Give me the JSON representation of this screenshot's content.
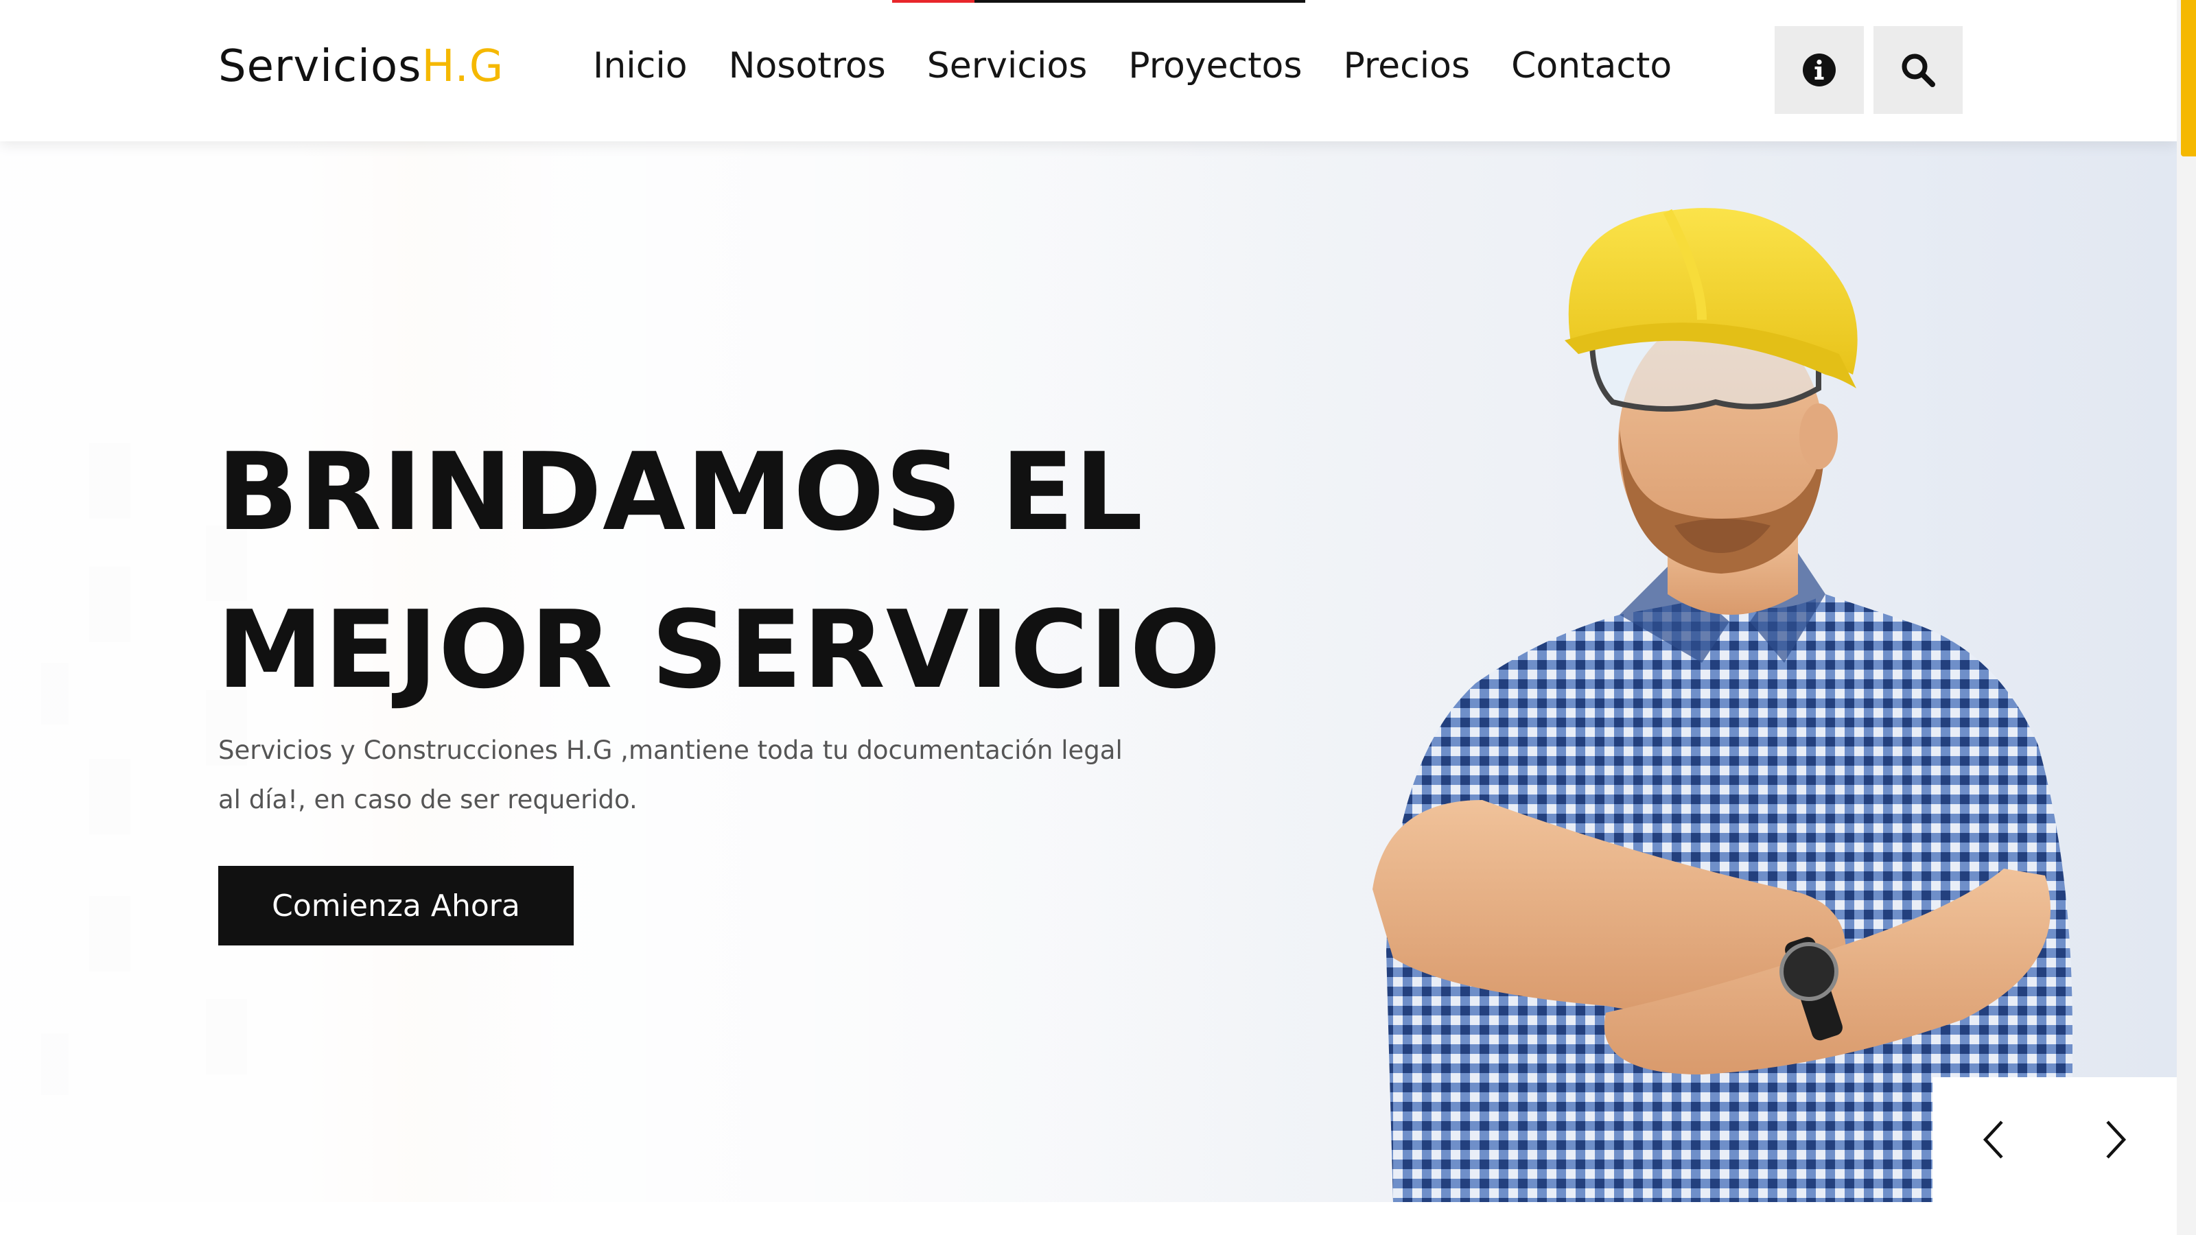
{
  "loading_bar": {
    "progress": 0.2
  },
  "header": {
    "logo": {
      "main": "Servicios",
      "accent": "H.G"
    },
    "nav": {
      "inicio": "Inicio",
      "nosotros": "Nosotros",
      "servicios": "Servicios",
      "proyectos": "Proyectos",
      "precios": "Precios",
      "contacto": "Contacto"
    },
    "icons": {
      "info": "info-icon",
      "search": "search-icon"
    }
  },
  "hero": {
    "headline_line1": "BRINDAMOS EL",
    "headline_line2": "MEJOR SERVICIO",
    "subtext": "Servicios y Construcciones H.G ,mantiene toda tu documentación legal al día!, en caso de ser requerido.",
    "cta_label": "Comienza Ahora"
  },
  "slider": {
    "prev_icon": "chevron-left-icon",
    "next_icon": "chevron-right-icon"
  },
  "colors": {
    "accent": "#f5b800",
    "dark": "#111111",
    "loading_red": "#e8262b",
    "icon_button_bg": "#ececec"
  }
}
